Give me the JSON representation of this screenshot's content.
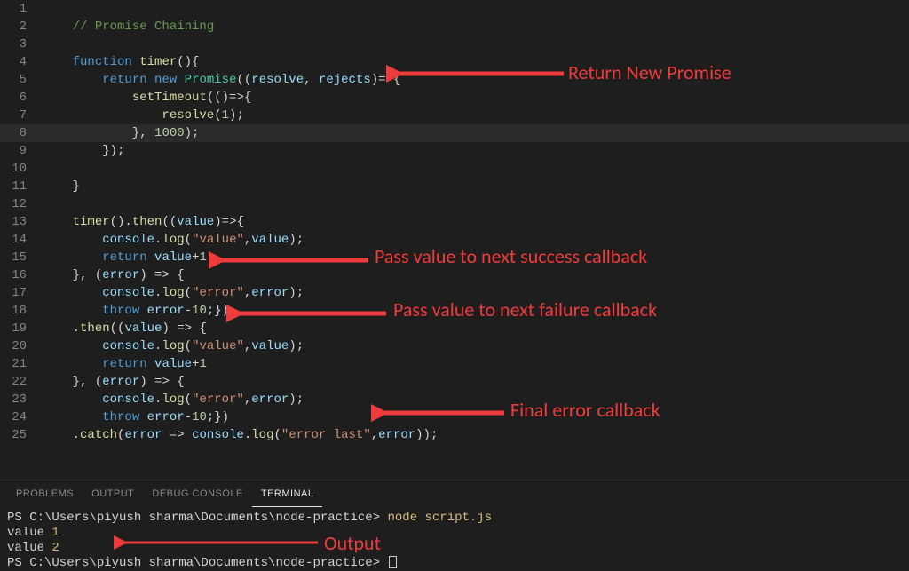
{
  "title_comment": "// Promise Chaining",
  "gutter": [
    "1",
    "2",
    "3",
    "4",
    "5",
    "6",
    "7",
    "8",
    "9",
    "10",
    "11",
    "12",
    "13",
    "14",
    "15",
    "16",
    "17",
    "18",
    "19",
    "20",
    "21",
    "22",
    "23",
    "24",
    "25"
  ],
  "annotations": {
    "a1": "Return New Promise",
    "a2": "Pass value to next success callback",
    "a3": "Pass value to next failure callback",
    "a4": "Final error callback",
    "a5": "Output"
  },
  "panel": {
    "tabs": [
      "PROBLEMS",
      "OUTPUT",
      "DEBUG CONSOLE",
      "TERMINAL"
    ],
    "active_tab": 3,
    "prompt_path": "PS C:\\Users\\piyush sharma\\Documents\\node-practice> ",
    "command": "node script.js",
    "out1_label": "value ",
    "out1_val": "1",
    "out2_label": "value ",
    "out2_val": "2"
  },
  "code": {
    "kw_function": "function",
    "fn_timer": "timer",
    "kw_return": "return",
    "kw_new": "new",
    "type_promise": "Promise",
    "param_resolve": "resolve",
    "param_rejects": "rejects",
    "fn_settimeout": "setTimeout",
    "fn_resolve": "resolve",
    "num_1": "1",
    "num_1000": "1000",
    "fn_then": "then",
    "param_value": "value",
    "obj_console": "console",
    "fn_log": "log",
    "str_value": "\"value\"",
    "var_value": "value",
    "kw_plus": "+",
    "param_error": "error",
    "str_error": "\"error\"",
    "var_error": "error",
    "kw_throw": "throw",
    "num_10": "10",
    "fn_catch": "catch",
    "str_error_last": "\"error last\""
  }
}
